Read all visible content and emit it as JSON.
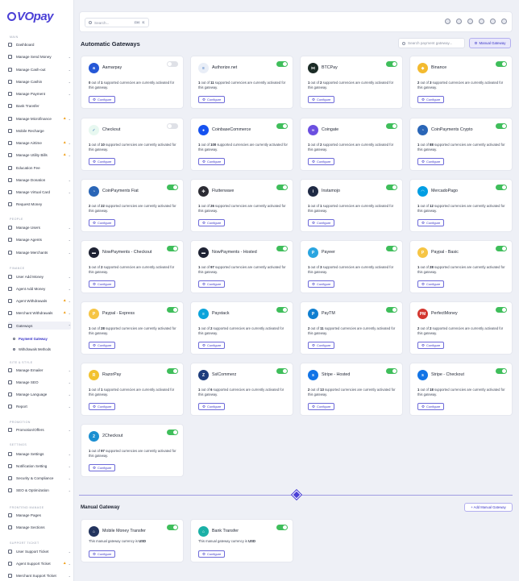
{
  "brand": {
    "name": "VOpay"
  },
  "topbar": {
    "search_placeholder": "Search...",
    "kbd1": "Ctrl",
    "kbd2": "K"
  },
  "sidebar": {
    "sections": [
      {
        "id": "main",
        "label": "MAIN"
      },
      {
        "id": "people",
        "label": "PEOPLE"
      },
      {
        "id": "finance",
        "label": "FINANCE"
      },
      {
        "id": "site",
        "label": "SITE & STYLE"
      },
      {
        "id": "promo",
        "label": "PROMOTION"
      },
      {
        "id": "settings",
        "label": "SETTINGS"
      },
      {
        "id": "frontend",
        "label": "FRONTEND MANAGE"
      },
      {
        "id": "support",
        "label": "SUPPORT TICKET"
      }
    ],
    "items": [
      {
        "label": "Dashboard"
      },
      {
        "label": "Manage Send Money"
      },
      {
        "label": "Manage Cash-out"
      },
      {
        "label": "Manage Cashin"
      },
      {
        "label": "Manage Payment"
      },
      {
        "label": "Bank Transfer"
      },
      {
        "label": "Manage Microfinance"
      },
      {
        "label": "Mobile Recharge"
      },
      {
        "label": "Manage Airtime"
      },
      {
        "label": "Manage Utility Bills"
      },
      {
        "label": "Education Fee"
      },
      {
        "label": "Manage Donation"
      },
      {
        "label": "Manage Virtual Card"
      },
      {
        "label": "Request Money"
      },
      {
        "label": "Manage Users"
      },
      {
        "label": "Manage Agents"
      },
      {
        "label": "Manage Merchants"
      },
      {
        "label": "User Add Money"
      },
      {
        "label": "Agent Add Money"
      },
      {
        "label": "Agent Withdrawals"
      },
      {
        "label": "Merchant Withdrawals"
      },
      {
        "label": "Gateways"
      },
      {
        "label": "Manage Emailer"
      },
      {
        "label": "Manage SEO"
      },
      {
        "label": "Manage Language"
      },
      {
        "label": "Report"
      },
      {
        "label": "Promotion/Offers"
      },
      {
        "label": "Manage Settings"
      },
      {
        "label": "Notification Setting"
      },
      {
        "label": "Security & Compliance"
      },
      {
        "label": "SEO & Optimization"
      },
      {
        "label": "Manage Pages"
      },
      {
        "label": "Manage Sections"
      },
      {
        "label": "User Support Ticket"
      },
      {
        "label": "Agent Support Ticket"
      },
      {
        "label": "Merchant Support Ticket"
      }
    ],
    "subitems": [
      {
        "label": "Payment Gateway"
      },
      {
        "label": "Withdrawals Methods"
      }
    ]
  },
  "main": {
    "auto_title": "Automatic Gateways",
    "gw_search_placeholder": "Search payment gateway...",
    "manual_button": "Manual Gateway",
    "configure_label": "Configure",
    "desc_suffix": "supported currencies are currently activated for this gateway.",
    "gateways": [
      {
        "name": "Aamarpay",
        "active": "0",
        "total": "1",
        "on": false,
        "color": "#2557d6",
        "icon": "a"
      },
      {
        "name": "Authorize.net",
        "active": "1",
        "total": "11",
        "on": true,
        "color": "#e9eef7",
        "icon": "≡"
      },
      {
        "name": "BTCPay",
        "active": "1",
        "total": "2",
        "on": true,
        "color": "#1b2b26",
        "icon": "⋈"
      },
      {
        "name": "Binance",
        "active": "2",
        "total": "3",
        "on": true,
        "color": "#f3ba2f",
        "icon": "◆"
      },
      {
        "name": "Checkout",
        "active": "1",
        "total": "10",
        "on": false,
        "color": "#e7f8f0",
        "icon": "✓"
      },
      {
        "name": "CoinbaseCommerce",
        "active": "1",
        "total": "100",
        "on": true,
        "color": "#1652f0",
        "icon": "●"
      },
      {
        "name": "Coingate",
        "active": "1",
        "total": "2",
        "on": true,
        "color": "#6b4fe0",
        "icon": "∞"
      },
      {
        "name": "CoinPayments Crypto",
        "active": "1",
        "total": "88",
        "on": true,
        "color": "#2a66b7",
        "icon": "◔"
      },
      {
        "name": "CoinPayments Fiat",
        "active": "2",
        "total": "22",
        "on": true,
        "color": "#2a66b7",
        "icon": "◔"
      },
      {
        "name": "Flutterwave",
        "active": "1",
        "total": "26",
        "on": true,
        "color": "#2c2c34",
        "icon": "✤"
      },
      {
        "name": "Instamojo",
        "active": "1",
        "total": "1",
        "on": true,
        "color": "#1f2a44",
        "icon": "i"
      },
      {
        "name": "MercadoPago",
        "active": "1",
        "total": "12",
        "on": true,
        "color": "#009ee3",
        "icon": "◠"
      },
      {
        "name": "NowPayments - Checkout",
        "active": "1",
        "total": "2",
        "on": true,
        "color": "#1e2233",
        "icon": "▬"
      },
      {
        "name": "NowPayments - Hosted",
        "active": "1",
        "total": "97",
        "on": true,
        "color": "#1e2233",
        "icon": "▬"
      },
      {
        "name": "Payeer",
        "active": "1",
        "total": "3",
        "on": true,
        "color": "#2aa5e0",
        "icon": "P"
      },
      {
        "name": "Paypal - Basic",
        "active": "1",
        "total": "28",
        "on": true,
        "color": "#f6c544",
        "icon": "P"
      },
      {
        "name": "Paypal - Express",
        "active": "1",
        "total": "28",
        "on": true,
        "color": "#f6c544",
        "icon": "P"
      },
      {
        "name": "Paystack",
        "active": "1",
        "total": "2",
        "on": true,
        "color": "#0ba4db",
        "icon": "≡"
      },
      {
        "name": "PayTM",
        "active": "2",
        "total": "11",
        "on": true,
        "color": "#0f7ed0",
        "icon": "P"
      },
      {
        "name": "PerfectMoney",
        "active": "2",
        "total": "2",
        "on": true,
        "color": "#d3362f",
        "icon": "PM"
      },
      {
        "name": "RazorPay",
        "active": "1",
        "total": "1",
        "on": true,
        "color": "#f2c230",
        "icon": "R"
      },
      {
        "name": "SslCommerz",
        "active": "1",
        "total": "6",
        "on": true,
        "color": "#1d3c7c",
        "icon": "Z"
      },
      {
        "name": "Stripe - Hosted",
        "active": "2",
        "total": "13",
        "on": true,
        "color": "#1274e6",
        "icon": "s"
      },
      {
        "name": "Stripe - Checkout",
        "active": "1",
        "total": "18",
        "on": true,
        "color": "#1274e6",
        "icon": "s"
      },
      {
        "name": "2Checkout",
        "active": "1",
        "total": "97",
        "on": true,
        "color": "#1b8fd1",
        "icon": "2"
      }
    ],
    "manual_title": "Manual Gateway",
    "add_manual_button": "+ Add Manual Gateway",
    "manual_desc_prefix": "This manual gateway currency is",
    "manual_gateways": [
      {
        "name": "Mobile Money Transfer",
        "currency": "USD",
        "on": true,
        "color": "#23345e",
        "icon": "⌂"
      },
      {
        "name": "Bank Transfer",
        "currency": "USD",
        "on": true,
        "color": "#1ab0a6",
        "icon": "⌂"
      }
    ]
  },
  "colors": {
    "accent": "#4a3fd6",
    "toggle_on": "#3fbe5b",
    "warn": "#f0a01c"
  }
}
